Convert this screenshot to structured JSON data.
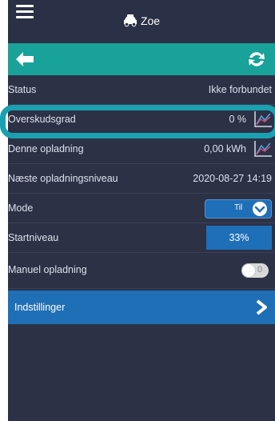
{
  "header": {
    "title": "Zoe"
  },
  "rows": [
    {
      "label": "Status",
      "value": "Ikke forbundet"
    },
    {
      "label": "Overskudsgrad",
      "value": "0 %"
    },
    {
      "label": "Denne opladning",
      "value": "0,00 kWh"
    },
    {
      "label": "Næste opladningsniveau",
      "value": "2020-08-27 14:19"
    },
    {
      "label": "Mode",
      "value": "Til"
    },
    {
      "label": "Startniveau",
      "value": "33%"
    },
    {
      "label": "Manuel opladning",
      "value": "0"
    }
  ],
  "settings": {
    "label": "Indstillinger"
  },
  "colors": {
    "background": "#2c3146",
    "actionbar": "#18a29a",
    "accent_blue": "#1e6fb8",
    "highlight": "#1aa0b0"
  },
  "icons": {
    "menu": "hamburger-menu-icon",
    "car": "car-icon",
    "back": "arrow-left-icon",
    "refresh": "refresh-icon",
    "chart": "line-chart-icon",
    "chevron": "chevron-down-icon",
    "next": "chevron-right-icon"
  }
}
